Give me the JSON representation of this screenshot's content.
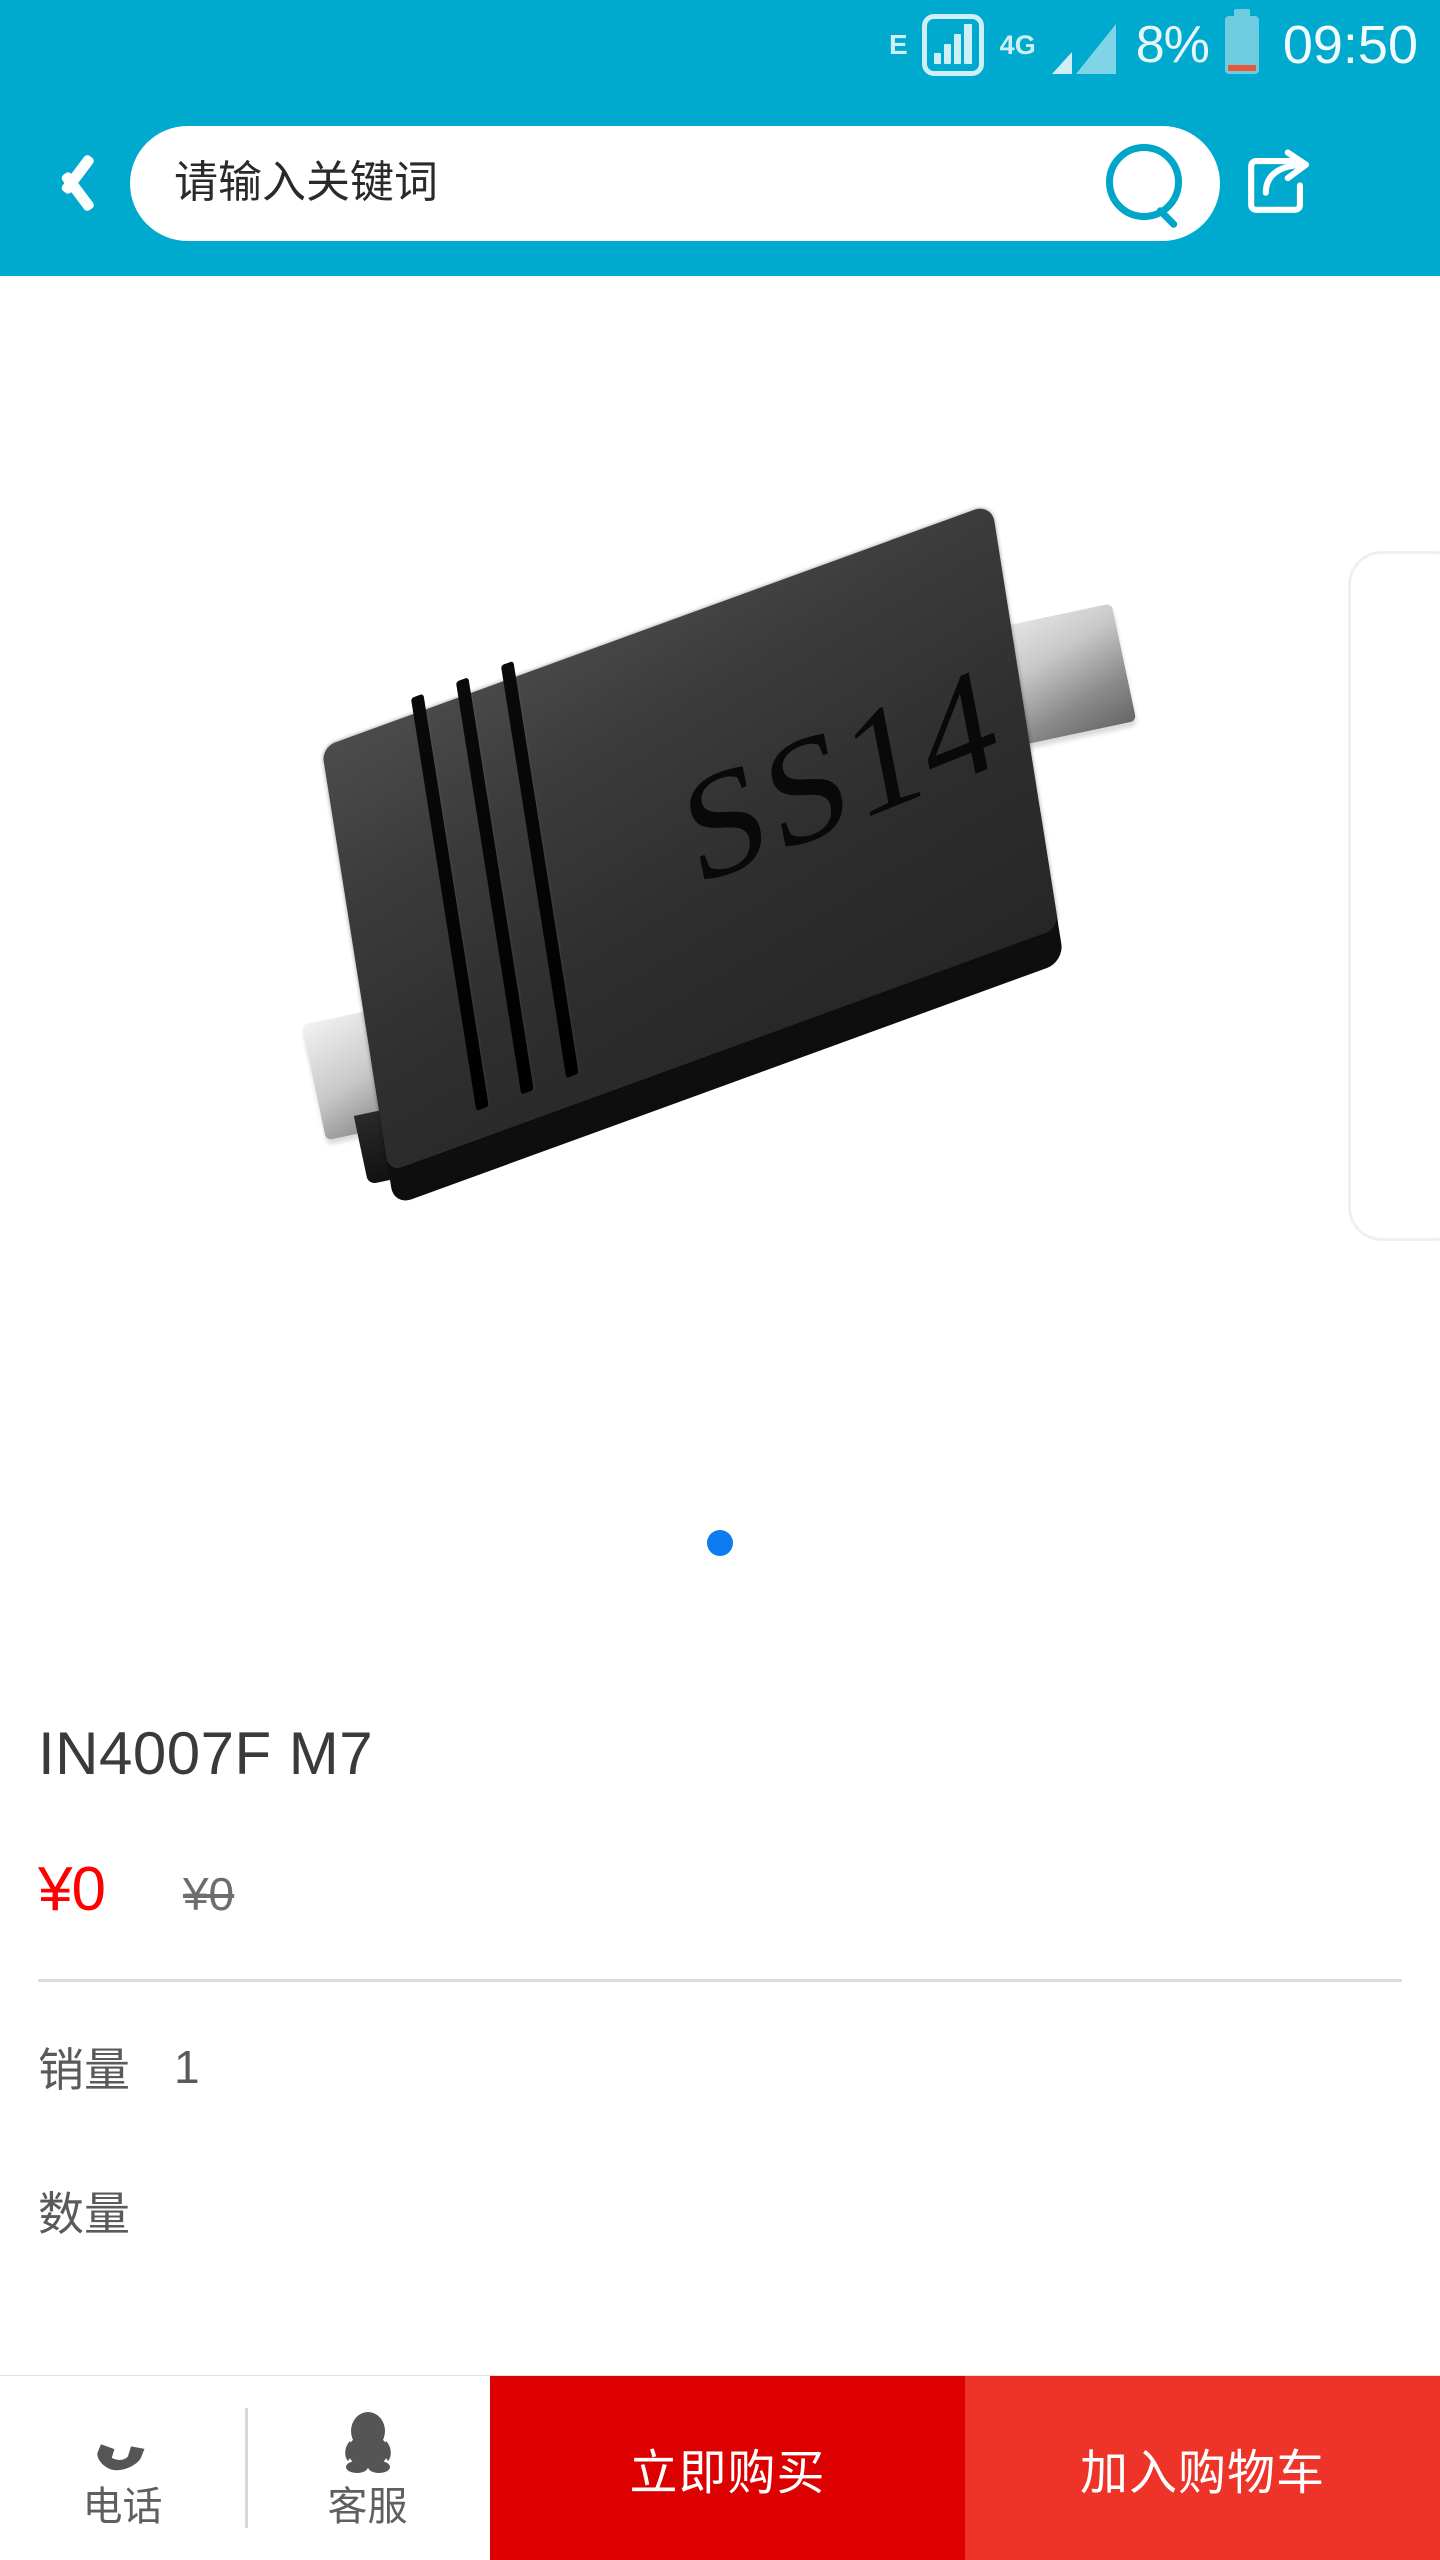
{
  "statusbar": {
    "network_label": "E",
    "network_type": "4G",
    "battery_percent": "8%",
    "time": "09:50",
    "icons": {
      "signal_box": "signal-bars-boxed-icon",
      "signal_bars": "signal-bars-icon",
      "battery": "battery-icon"
    }
  },
  "header": {
    "back_icon": "back-chevron-icon",
    "search_placeholder": "请输入关键词",
    "search_value": "",
    "search_icon": "search-icon",
    "share_icon": "share-icon",
    "background_color": "#00AACE"
  },
  "gallery": {
    "product_marking": "SS14",
    "dots": [
      "dot-1"
    ],
    "active_dot_index": 0,
    "dot_color": "#0A7CF0"
  },
  "product": {
    "title": "IN4007F M7",
    "price_current": "¥0",
    "price_original": "¥0",
    "price_color": "#FF0000",
    "sales_label": "销量",
    "sales_value": "1",
    "quantity_label": "数量"
  },
  "bottombar": {
    "phone_label": "电话",
    "phone_icon": "phone-icon",
    "service_label": "客服",
    "service_icon": "qq-penguin-icon",
    "buy_now_label": "立即购买",
    "add_cart_label": "加入购物车",
    "buy_now_color": "#DD0000",
    "add_cart_color": "#EE3329"
  }
}
